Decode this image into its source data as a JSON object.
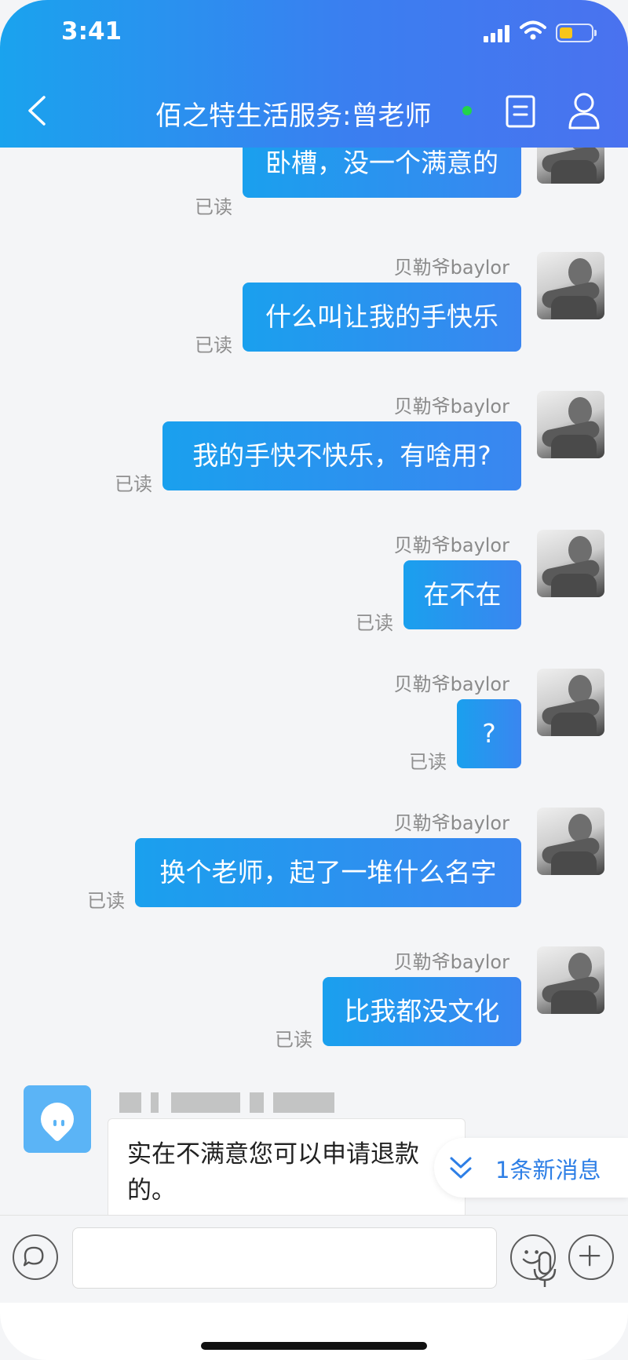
{
  "status_bar": {
    "time": "3:41"
  },
  "header": {
    "title": "佰之特生活服务:曾老师",
    "colors": {
      "gradient_start": "#1aa3ee",
      "gradient_end": "#4a72ef",
      "online": "#22d34b"
    }
  },
  "messages": [
    {
      "text": "卧槽，没一个满意的",
      "read": "已读"
    },
    {
      "sender": "贝勒爷baylor",
      "text": "什么叫让我的手快乐",
      "read": "已读"
    },
    {
      "sender": "贝勒爷baylor",
      "text": "我的手快不快乐，有啥用?",
      "read": "已读"
    },
    {
      "sender": "贝勒爷baylor",
      "text": "在不在",
      "read": "已读"
    },
    {
      "sender": "贝勒爷baylor",
      "text": "?",
      "read": "已读"
    },
    {
      "sender": "贝勒爷baylor",
      "text": "换个老师，起了一堆什么名字",
      "read": "已读"
    },
    {
      "sender": "贝勒爷baylor",
      "text": "比我都没文化",
      "read": "已读"
    }
  ],
  "incoming": {
    "text_line1": "实在不满意您可以申请退款",
    "text_line2": "的。"
  },
  "new_message_pill": {
    "label": "1条新消息"
  },
  "input_bar": {
    "icons": [
      "chat-bubble-icon",
      "microphone-icon",
      "emoji-icon",
      "plus-icon"
    ]
  }
}
